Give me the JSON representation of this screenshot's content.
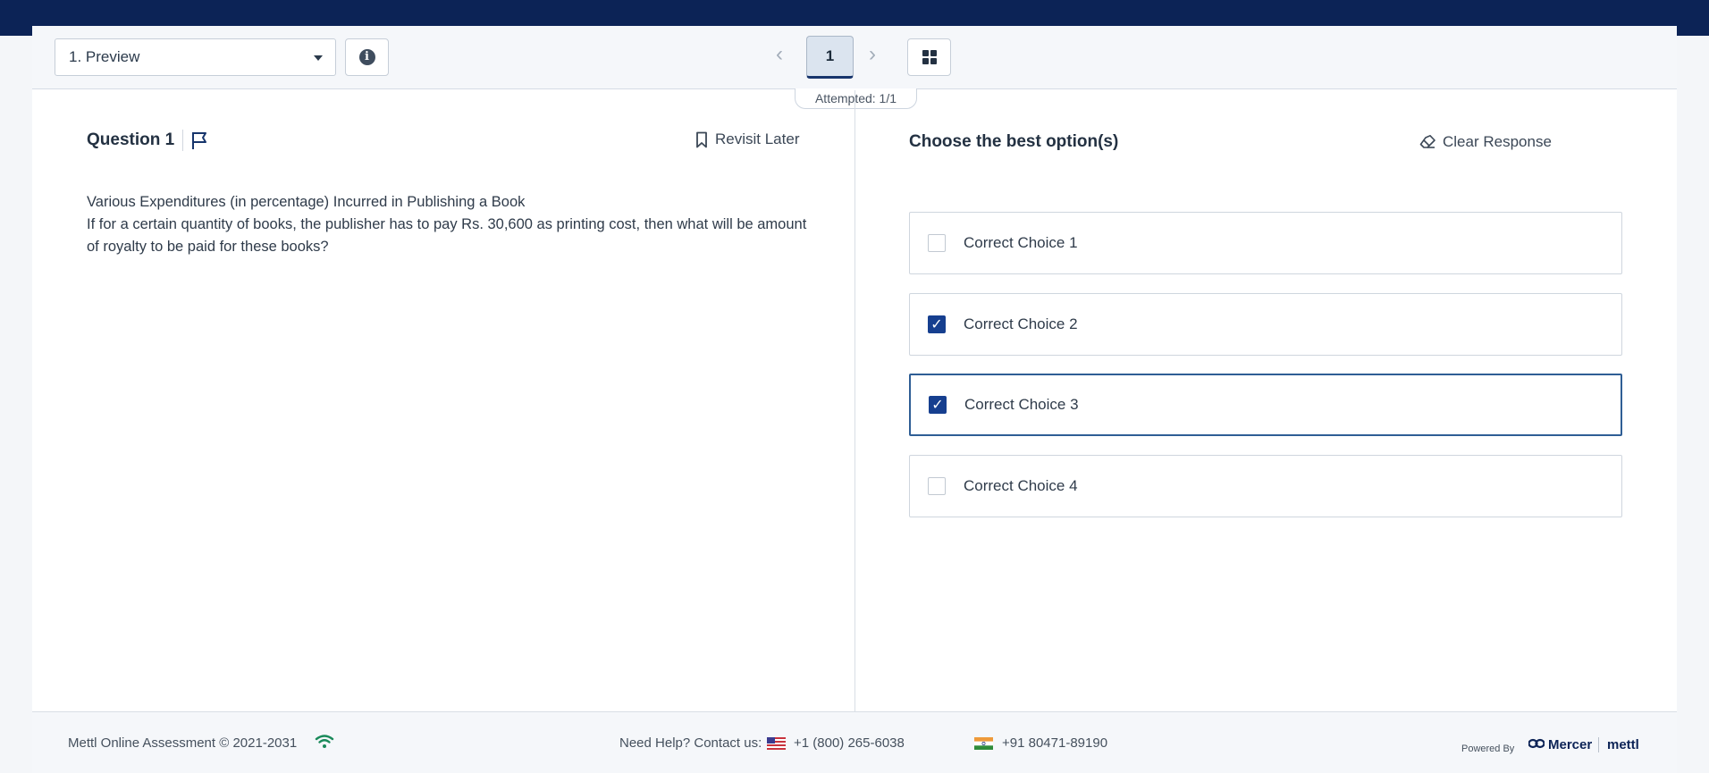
{
  "toolbar": {
    "section_select": "1. Preview",
    "current_page": "1",
    "prev_arrow": "‹",
    "next_arrow": "›",
    "attempted": "Attempted: 1/1"
  },
  "question": {
    "title": "Question 1",
    "revisit_label": "Revisit Later",
    "line1": "Various Expenditures (in percentage) Incurred in Publishing a Book",
    "line2": "If for a certain quantity of books, the publisher has to pay Rs. 30,600 as printing cost, then what will be amount of royalty to be paid for these books?"
  },
  "answer": {
    "title": "Choose the best option(s)",
    "clear_label": "Clear Response",
    "options": [
      {
        "label": "Correct Choice 1",
        "checked": false,
        "mark": ""
      },
      {
        "label": "Correct Choice 2",
        "checked": true,
        "mark": "✓"
      },
      {
        "label": "Correct Choice 3",
        "checked": true,
        "mark": "✓"
      },
      {
        "label": "Correct Choice 4",
        "checked": false,
        "mark": ""
      }
    ]
  },
  "footer": {
    "copyright": "Mettl Online Assessment © 2021-2031",
    "help": "Need Help? Contact us:",
    "phone_us": "+1 (800) 265-6038",
    "phone_in": "+91 80471-89190",
    "powered_by": "Powered By",
    "brand1": "Mercer",
    "brand2": "mettl"
  },
  "colors": {
    "topbar": "#0c2356",
    "checkbox_checked": "#163f8f",
    "focus_border": "#2f5e95",
    "wifi": "#1a8a5a"
  }
}
